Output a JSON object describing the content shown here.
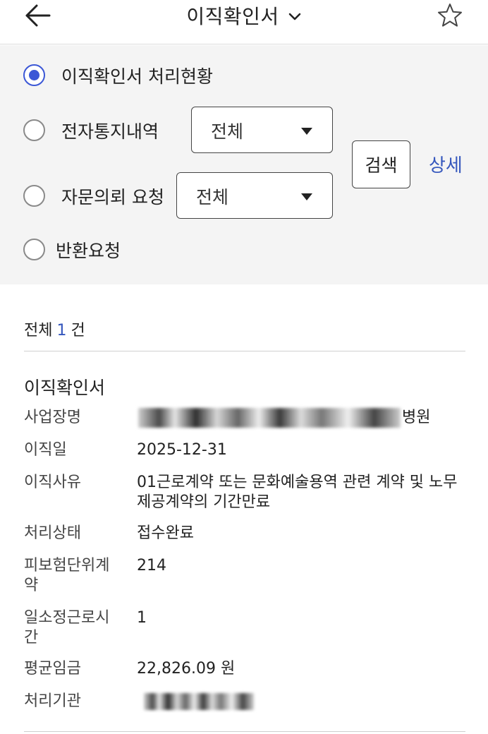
{
  "header": {
    "title": "이직확인서",
    "back_icon": "arrow-left-icon",
    "dropdown_icon": "chevron-down-icon",
    "favorite_icon": "star-outline-icon"
  },
  "filters": {
    "options": [
      {
        "label": "이직확인서 처리현황",
        "selected": true
      },
      {
        "label": "전자통지내역",
        "selected": false,
        "select_value": "전체"
      },
      {
        "label": "자문의뢰 요청",
        "selected": false,
        "select_value": "전체"
      },
      {
        "label": "반환요청",
        "selected": false
      }
    ],
    "search_label": "검색",
    "detail_label": "상세",
    "accent_color": "#3b57d6"
  },
  "results": {
    "count_prefix": "전체",
    "count": "1",
    "count_suffix": "건"
  },
  "card": {
    "title": "이직확인서",
    "rows": [
      {
        "label": "사업장명",
        "value": "병원"
      },
      {
        "label": "이직일",
        "value": "2025-12-31"
      },
      {
        "label": "이직사유",
        "value": "01근로계약 또는 문화예술용역 관련 계약 및 노무제공계약의 기간만료"
      },
      {
        "label": "처리상태",
        "value": "접수완료"
      },
      {
        "label": "피보험단위계약",
        "value": "214"
      },
      {
        "label": "일소정근로시간",
        "value": "1"
      },
      {
        "label": "평균임금",
        "value": "22,826.09 원"
      },
      {
        "label": "처리기관",
        "value": ""
      }
    ]
  }
}
